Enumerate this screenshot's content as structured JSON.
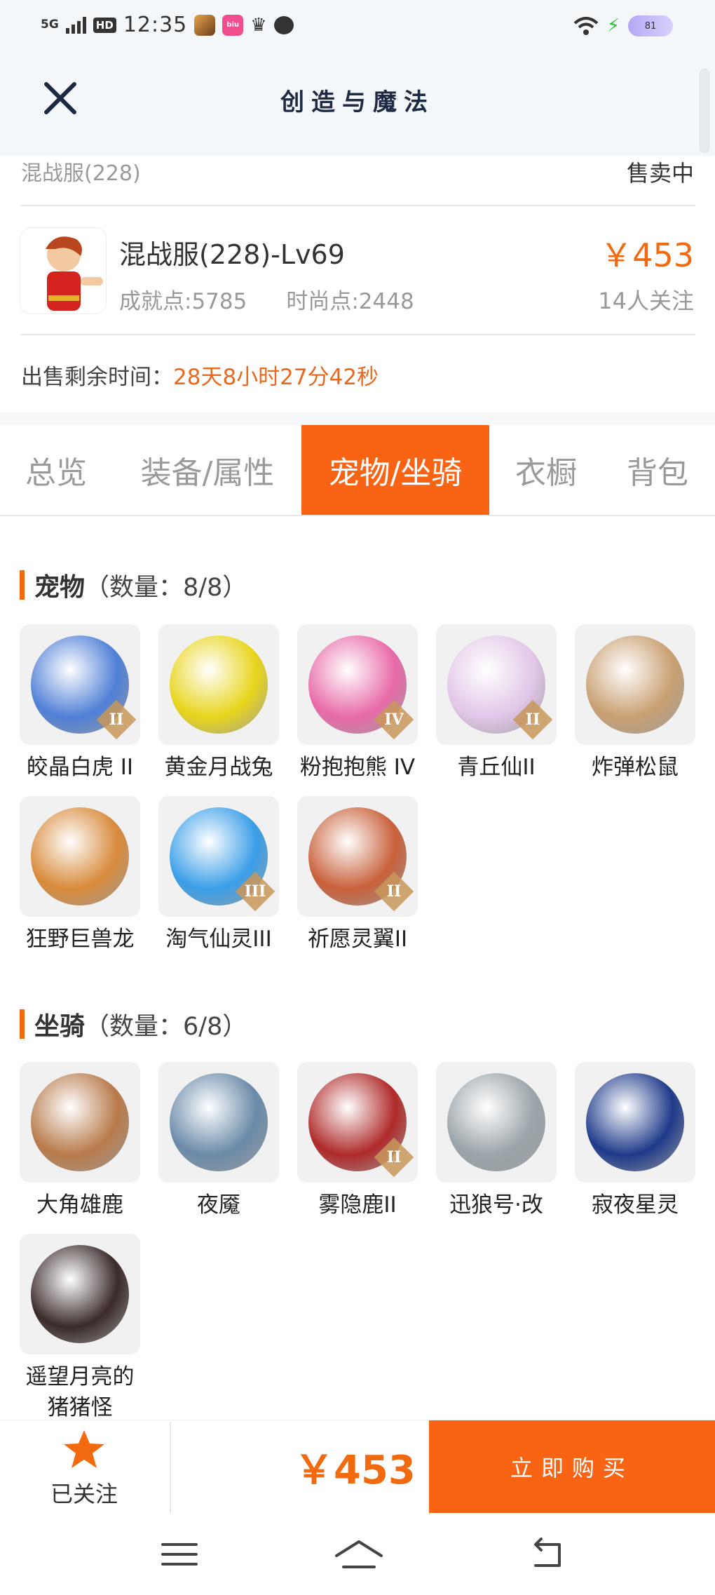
{
  "status_bar": {
    "signal": "5G",
    "hd": "HD",
    "time": "12:35",
    "app2_text": "biu",
    "battery": "81"
  },
  "header": {
    "title": "创造与魔法"
  },
  "listing": {
    "server": "混战服(228)",
    "status": "售卖中",
    "char_name": "混战服(228)-Lv69",
    "achievement": "成就点:5785",
    "fashion": "时尚点:2448",
    "price": "￥453",
    "followers": "14人关注",
    "remain_label": "出售剩余时间：",
    "remain_value": "28天8小时27分42秒"
  },
  "tabs": [
    {
      "label": "总览"
    },
    {
      "label": "装备/属性"
    },
    {
      "label": "宠物/坐骑"
    },
    {
      "label": "衣橱"
    },
    {
      "label": "背包"
    }
  ],
  "active_tab": "宠物/坐骑",
  "pets": {
    "title": "宠物",
    "count": "（数量：8/8）",
    "items": [
      {
        "name": "皎晶白虎 II",
        "badge": "II",
        "color": "#4f7fd6",
        "icon": "tiger-icon"
      },
      {
        "name": "黄金月战兔",
        "badge": "",
        "color": "#e8d51c",
        "icon": "rabbit-icon"
      },
      {
        "name": "粉抱抱熊 IV",
        "badge": "IV",
        "color": "#e86aa8",
        "icon": "bear-icon"
      },
      {
        "name": "青丘仙II",
        "badge": "II",
        "color": "#e2c6e8",
        "icon": "fox-fairy-icon"
      },
      {
        "name": "炸弹松鼠",
        "badge": "",
        "color": "#c9a072",
        "icon": "squirrel-icon"
      },
      {
        "name": "狂野巨兽龙",
        "badge": "",
        "color": "#d88a3a",
        "icon": "dragon-icon"
      },
      {
        "name": "淘气仙灵III",
        "badge": "III",
        "color": "#3a9ee8",
        "icon": "spirit-icon"
      },
      {
        "name": "祈愿灵翼II",
        "badge": "II",
        "color": "#c8603a",
        "icon": "bird-icon"
      }
    ]
  },
  "mounts": {
    "title": "坐骑",
    "count": "（数量：6/8）",
    "items": [
      {
        "name": "大角雄鹿",
        "badge": "",
        "color": "#b87a4a",
        "icon": "stag-icon"
      },
      {
        "name": "夜魇",
        "badge": "",
        "color": "#6a8aa8",
        "icon": "night-horse-icon"
      },
      {
        "name": "雾隐鹿II",
        "badge": "II",
        "color": "#b02a2a",
        "icon": "mist-deer-icon"
      },
      {
        "name": "迅狼号·改",
        "badge": "",
        "color": "#9aa4aa",
        "icon": "mech-wolf-icon"
      },
      {
        "name": "寂夜星灵",
        "badge": "",
        "color": "#1e3a8a",
        "icon": "star-spirit-icon"
      },
      {
        "name": "遥望月亮的猪猪怪",
        "badge": "",
        "color": "#3a2a2a",
        "icon": "pig-icon"
      }
    ]
  },
  "bottom": {
    "follow_label": "已关注",
    "price": "￥453",
    "buy_label": "立即购买"
  },
  "colors": {
    "accent": "#f86314",
    "price": "#f26a10"
  }
}
